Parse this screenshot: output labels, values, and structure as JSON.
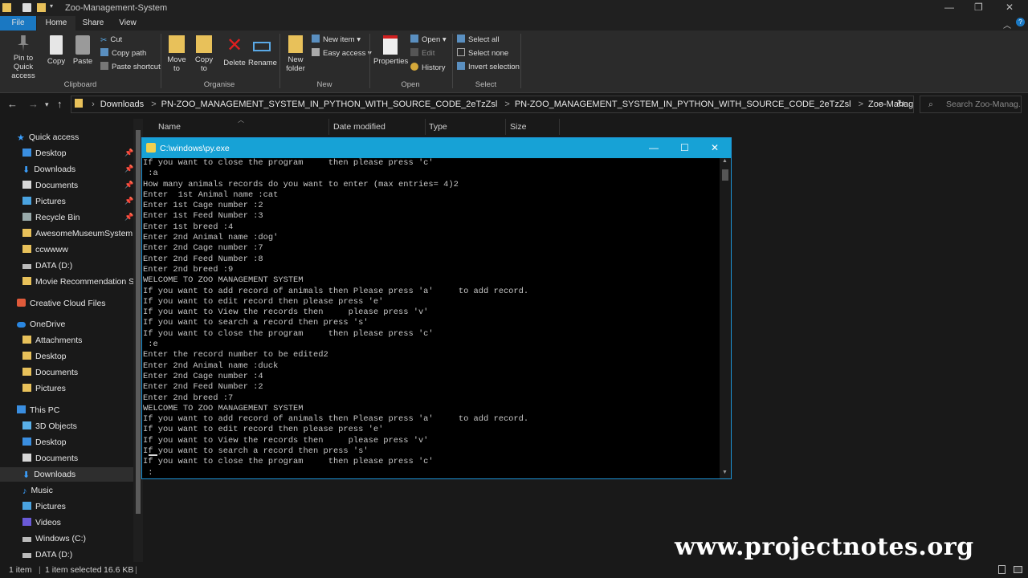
{
  "window": {
    "title": "Zoo-Management-System"
  },
  "tabs": [
    "File",
    "Home",
    "Share",
    "View"
  ],
  "ribbon": {
    "clipboard": {
      "pin": "Pin to Quick access",
      "copy": "Copy",
      "paste": "Paste",
      "cut": "Cut",
      "copy_path": "Copy path",
      "paste_shortcut": "Paste shortcut",
      "label": "Clipboard"
    },
    "organise": {
      "move_to": "Move to",
      "copy_to": "Copy to",
      "delete": "Delete",
      "rename": "Rename",
      "label": "Organise"
    },
    "new": {
      "new_folder": "New folder",
      "new_item": "New item",
      "easy_access": "Easy access",
      "label": "New"
    },
    "open": {
      "properties": "Properties",
      "open": "Open",
      "edit": "Edit",
      "history": "History",
      "label": "Open"
    },
    "select": {
      "select_all": "Select all",
      "select_none": "Select none",
      "invert": "Invert selection",
      "label": "Select"
    }
  },
  "address": {
    "crumbs": [
      "Downloads",
      "PN-ZOO_MANAGEMENT_SYSTEM_IN_PYTHON_WITH_SOURCE_CODE_2eTzZsl",
      "PN-ZOO_MANAGEMENT_SYSTEM_IN_PYTHON_WITH_SOURCE_CODE_2eTzZsl",
      "Zoo-Management-System"
    ],
    "separator": ">",
    "search_placeholder": "Search Zoo-Manag..."
  },
  "columns": [
    "Name",
    "Date modified",
    "Type",
    "Size"
  ],
  "sidebar": {
    "quick_access": "Quick access",
    "quick_items": [
      "Desktop",
      "Downloads",
      "Documents",
      "Pictures",
      "Recycle Bin",
      "AwesomeMuseumSystem",
      "ccwwww",
      "DATA (D:)",
      "Movie Recommendation Sys"
    ],
    "creative_cloud": "Creative Cloud Files",
    "onedrive": "OneDrive",
    "onedrive_items": [
      "Attachments",
      "Desktop",
      "Documents",
      "Pictures"
    ],
    "this_pc": "This PC",
    "pc_items": [
      "3D Objects",
      "Desktop",
      "Documents",
      "Downloads",
      "Music",
      "Pictures",
      "Videos",
      "Windows (C:)",
      "DATA (D:)"
    ]
  },
  "console": {
    "title": "C:\\windows\\py.exe",
    "lines": [
      "If you want to close the program     then please press 'c'",
      " :a",
      "How many animals records do you want to enter (max entries= 4)2",
      "Enter  1st Animal name :cat",
      "Enter 1st Cage number :2",
      "Enter 1st Feed Number :3",
      "Enter 1st breed :4",
      "Enter 2nd Animal name :dog'",
      "Enter 2nd Cage number :7",
      "Enter 2nd Feed Number :8",
      "Enter 2nd breed :9",
      "WELCOME TO ZOO MANAGEMENT SYSTEM",
      "If you want to add record of animals then Please press 'a'     to add record.",
      "If you want to edit record then please press 'e'",
      "If you want to View the records then     please press 'v'",
      "If you want to search a record then press 's'",
      "If you want to close the program     then please press 'c'",
      " :e",
      "Enter the record number to be edited2",
      "Enter 2nd Animal name :duck",
      "Enter 2nd Cage number :4",
      "Enter 2nd Feed Number :2",
      "Enter 2nd breed :7",
      "WELCOME TO ZOO MANAGEMENT SYSTEM",
      "If you want to add record of animals then Please press 'a'     to add record.",
      "If you want to edit record then please press 'e'",
      "If you want to View the records then     please press 'v'",
      "If you want to search a record then press 's'",
      "If you want to close the program     then please press 'c'",
      " :"
    ]
  },
  "status": {
    "count": "1 item",
    "selected": "1 item selected",
    "size": "16.6 KB"
  },
  "watermark": "www.projectnotes.org",
  "colors": {
    "accent": "#1a78c2",
    "console_title": "#17a2d6",
    "folder": "#e8c15a"
  }
}
